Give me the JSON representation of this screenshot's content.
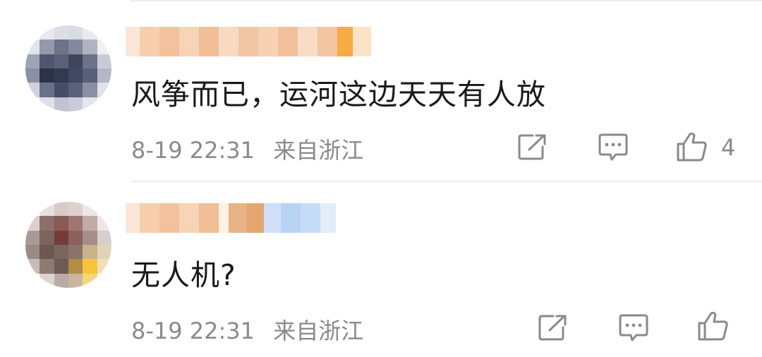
{
  "comments": [
    {
      "text": "风筝而已，运河这边天天有人放",
      "time": "8-19 22:31",
      "location": "来自浙江",
      "likes": "4"
    },
    {
      "text": "无人机?",
      "time": "8-19 22:31",
      "location": "来自浙江",
      "likes": ""
    }
  ],
  "icons": {
    "share": "share-icon",
    "reply": "comment-icon",
    "like": "thumbs-up-icon"
  },
  "colors": {
    "text": "#1a1a1a",
    "meta": "#8a8a8a",
    "divider": "#ededed"
  }
}
